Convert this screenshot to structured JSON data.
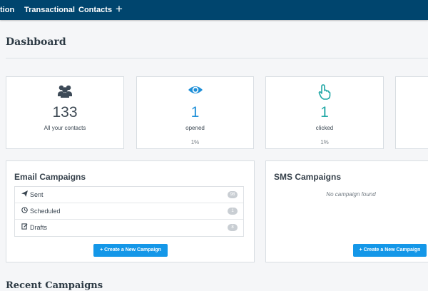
{
  "nav": {
    "items": [
      "tion",
      "Transactional",
      "Contacts"
    ],
    "plus": "+"
  },
  "page": {
    "title": "Dashboard"
  },
  "stats": [
    {
      "icon": "users-icon",
      "value": "133",
      "label": "All your contacts",
      "percent": ""
    },
    {
      "icon": "eye-icon",
      "value": "1",
      "label": "opened",
      "percent": "1%"
    },
    {
      "icon": "pointer-hand-icon",
      "value": "1",
      "label": "clicked",
      "percent": "1%"
    }
  ],
  "email_campaigns": {
    "title": "Email Campaigns",
    "rows": [
      {
        "icon": "send-icon",
        "label": "Sent",
        "count": "98"
      },
      {
        "icon": "clock-icon",
        "label": "Scheduled",
        "count": "1"
      },
      {
        "icon": "draft-icon",
        "label": "Drafts",
        "count": "8"
      }
    ],
    "button": "+ Create a New Campaign"
  },
  "sms_campaigns": {
    "title": "SMS Campaigns",
    "empty_text": "No campaign found",
    "button": "+ Create a New Campaign"
  },
  "bottom": {
    "title": "Recent Campaigns"
  },
  "colors": {
    "nav": "#00456e",
    "accent": "#1497e8",
    "teal": "#20a7a5"
  }
}
